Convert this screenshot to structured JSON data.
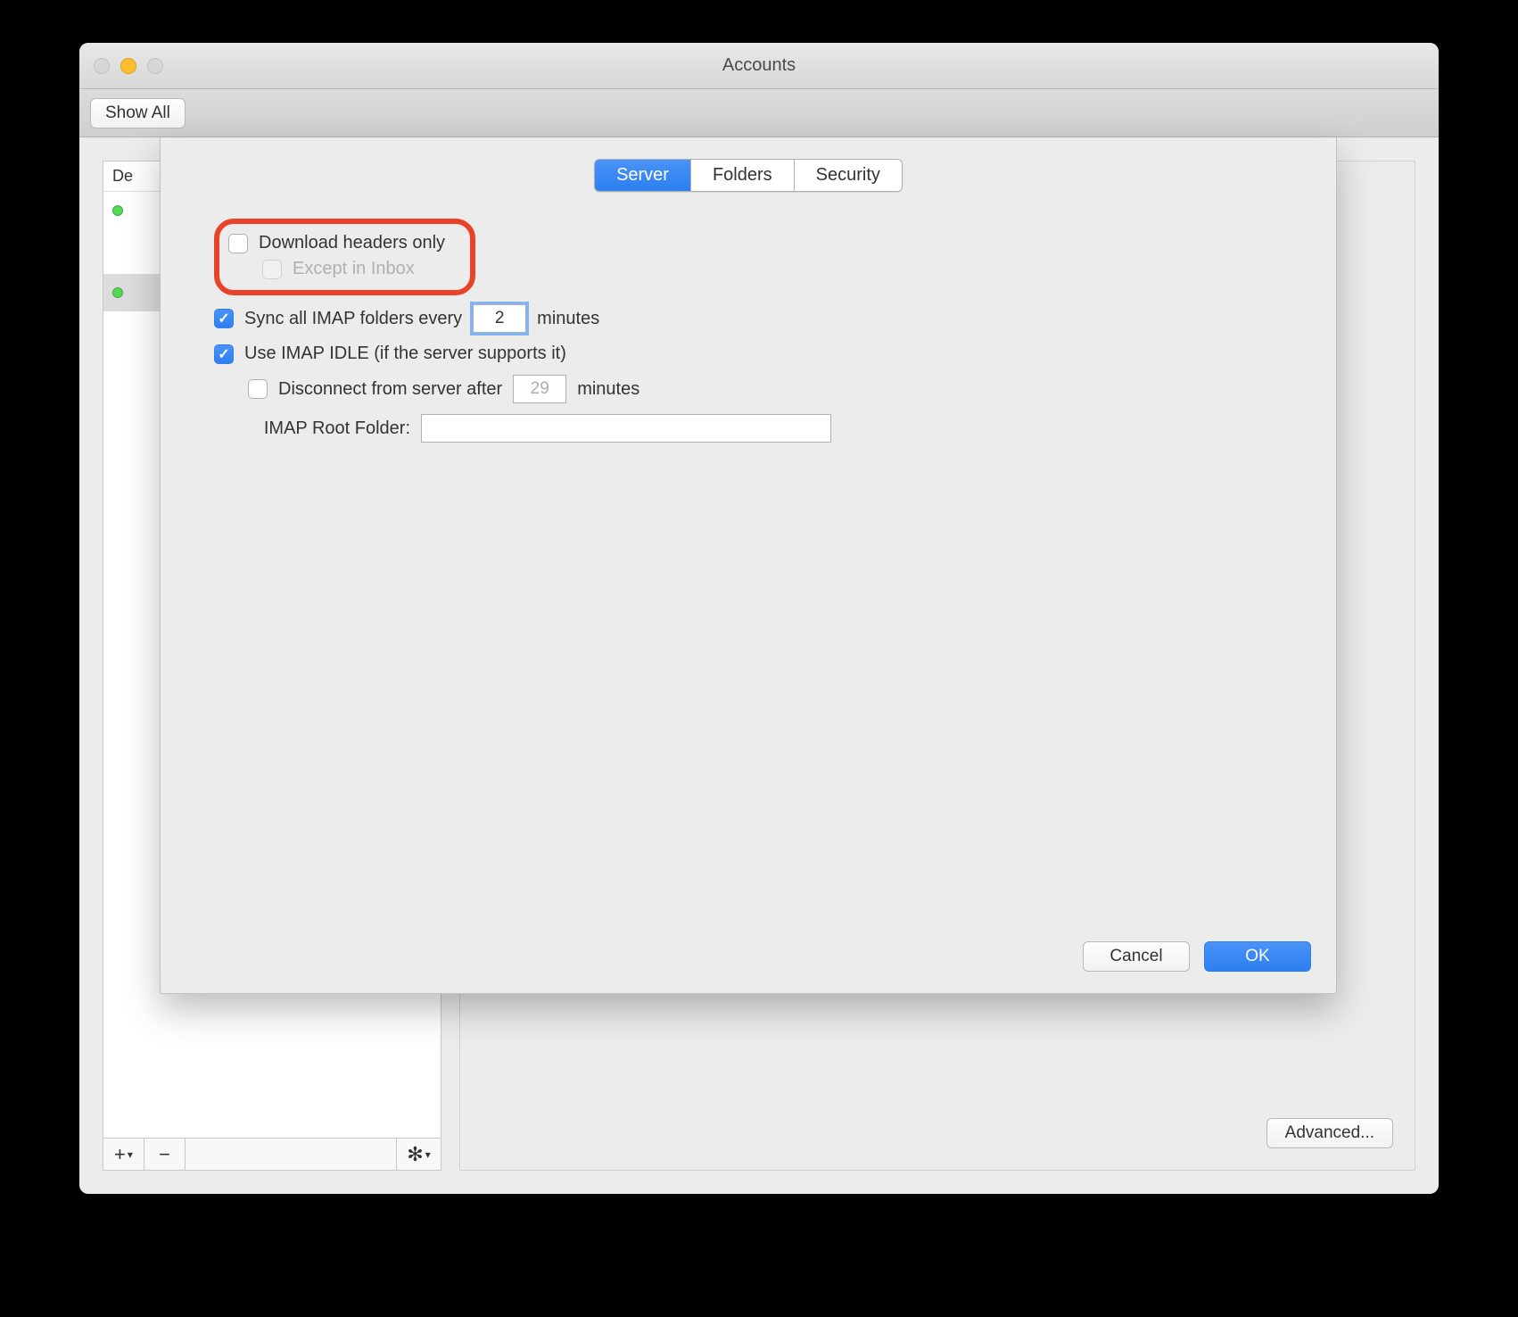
{
  "window": {
    "title": "Accounts"
  },
  "toolbar": {
    "show_all": "Show All"
  },
  "sidebar": {
    "header": "De",
    "add_label": "+",
    "remove_label": "−"
  },
  "main": {
    "advanced": "Advanced..."
  },
  "sheet": {
    "tabs": {
      "server": "Server",
      "folders": "Folders",
      "security": "Security"
    },
    "download_headers": "Download headers only",
    "except_inbox": "Except in Inbox",
    "sync_prefix": "Sync all IMAP folders every",
    "sync_value": "2",
    "sync_suffix": "minutes",
    "idle": "Use IMAP IDLE (if the server supports it)",
    "disconnect_prefix": "Disconnect from server after",
    "disconnect_value": "29",
    "disconnect_suffix": "minutes",
    "root_folder_label": "IMAP Root Folder:",
    "root_folder_value": "",
    "cancel": "Cancel",
    "ok": "OK"
  }
}
